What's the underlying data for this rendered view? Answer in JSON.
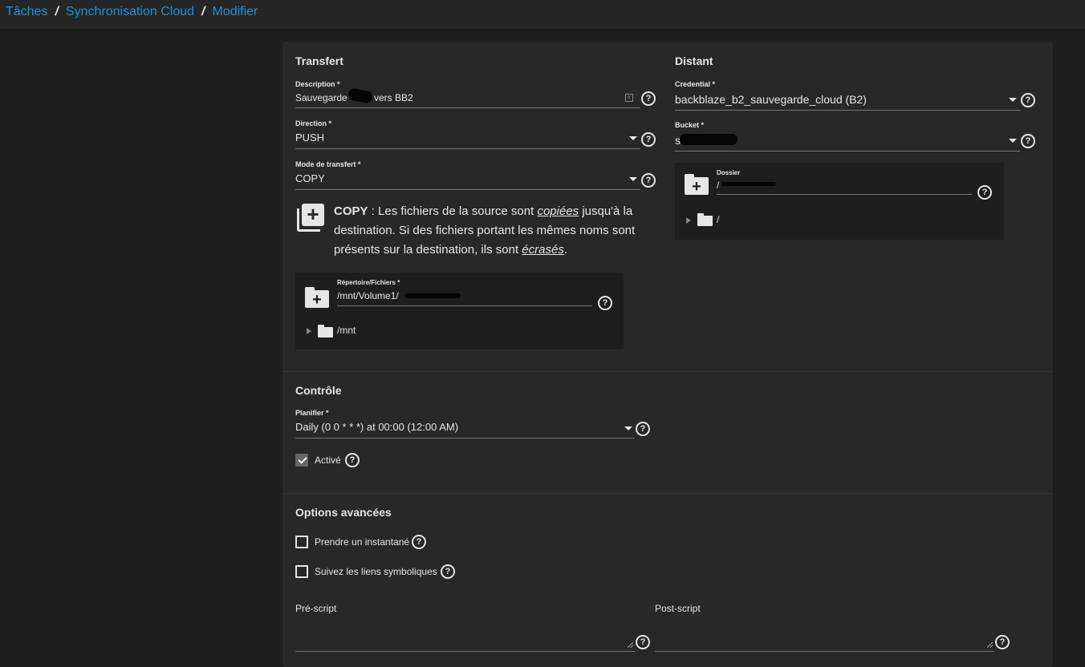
{
  "breadcrumb": {
    "items": [
      "Tâches",
      "Synchronisation Cloud",
      "Modifier"
    ],
    "separator": "/"
  },
  "transfer": {
    "title": "Transfert",
    "description": {
      "label": "Description *",
      "value_prefix": "Sauvegarde",
      "value_suffix": "vers BB2"
    },
    "direction": {
      "label": "Direction *",
      "value": "PUSH"
    },
    "mode": {
      "label": "Mode de transfert *",
      "value": "COPY"
    },
    "mode_help": {
      "bold": "COPY",
      "t1": " : Les fichiers de la source sont ",
      "em1": "copiées",
      "t2": " jusqu'à la destination. Si des fichiers portant les mêmes noms sont présents sur la destination, ils sont ",
      "em2": "écrasés",
      "t3": "."
    },
    "source": {
      "label": "Répertoire/Fichiers *",
      "value": "/mnt/Volume1/",
      "tree_root": "/mnt"
    }
  },
  "remote": {
    "title": "Distant",
    "credential": {
      "label": "Credential *",
      "value": "backblaze_b2_sauvegarde_cloud (B2)"
    },
    "bucket": {
      "label": "Bucket *",
      "value": "s"
    },
    "folder": {
      "label": "Dossier",
      "value": "/",
      "tree_root": "/"
    }
  },
  "control": {
    "title": "Contrôle",
    "schedule": {
      "label": "Planifier *",
      "value": "Daily (0 0 * * *) at 00:00 (12:00 AM)"
    },
    "enabled": {
      "label": "Activé",
      "checked": true
    }
  },
  "advanced": {
    "title": "Options avancées",
    "snapshot": {
      "label": "Prendre un instantané",
      "checked": false
    },
    "follow_symlinks": {
      "label": "Suivez les liens symboliques",
      "checked": false
    },
    "pre_script": {
      "label": "Pré-script",
      "value": ""
    },
    "post_script": {
      "label": "Post-script",
      "value": ""
    }
  },
  "icons": {
    "help": "help-circle-icon",
    "dropdown": "dropdown-arrow-icon",
    "folder_add": "folder-add-icon",
    "folder": "folder-icon",
    "copy": "library-add-icon"
  },
  "colors": {
    "accent": "#1f90d6",
    "background": "#1e1e1e",
    "card": "#282828",
    "text": "#e6e6e6"
  }
}
